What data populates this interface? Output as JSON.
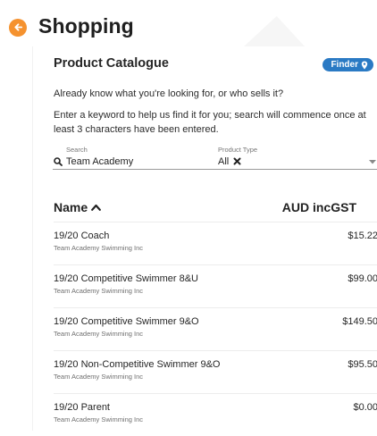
{
  "header": {
    "title": "Shopping"
  },
  "catalogue": {
    "title": "Product Catalogue",
    "finder_label": "Finder",
    "intro": "Already know what you're looking for, or who sells it?",
    "instructions": "Enter a keyword to help us find it for you; search will commence once at least 3 characters have been entered."
  },
  "search": {
    "label": "Search",
    "value": "Team Academy"
  },
  "product_type": {
    "label": "Product Type",
    "value": "All"
  },
  "table": {
    "col_name": "Name",
    "col_price": "AUD incGST",
    "rows": [
      {
        "name": "19/20 Coach",
        "seller": "Team Academy Swimming Inc",
        "price": "$15.22"
      },
      {
        "name": "19/20 Competitive Swimmer 8&U",
        "seller": "Team Academy Swimming Inc",
        "price": "$99.00"
      },
      {
        "name": "19/20 Competitive Swimmer 9&O",
        "seller": "Team Academy Swimming Inc",
        "price": "$149.50"
      },
      {
        "name": "19/20 Non-Competitive Swimmer 9&O",
        "seller": "Team Academy Swimming Inc",
        "price": "$95.50"
      },
      {
        "name": "19/20 Parent",
        "seller": "Team Academy Swimming Inc",
        "price": "$0.00"
      }
    ]
  },
  "colors": {
    "back_button": "#f5922f",
    "finder_badge": "#2a7ac4",
    "text": "#212121",
    "muted": "#6f6f6f"
  },
  "icons": {
    "back": "arrow-left-icon",
    "finder": "map-pin-icon",
    "search": "search-icon",
    "clear": "close-icon",
    "sort": "chevron-up-icon",
    "dropdown": "caret-down-icon"
  }
}
